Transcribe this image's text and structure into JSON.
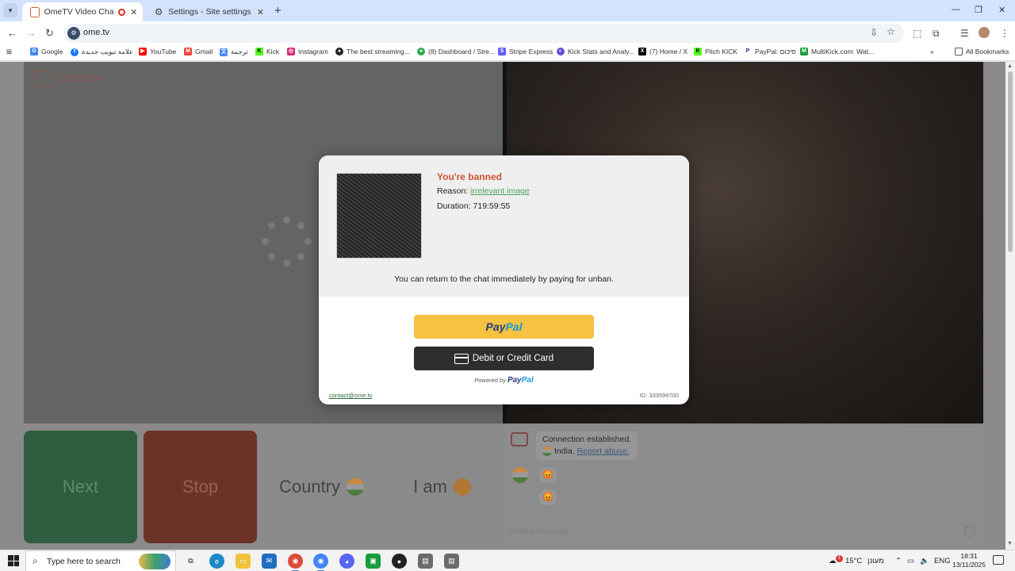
{
  "browser": {
    "tabs": [
      {
        "title": "OmeTV Video Chat — Ome",
        "active": true
      },
      {
        "title": "Settings - Site settings",
        "active": false
      }
    ],
    "url": "ome.tv",
    "bookmarks": [
      {
        "label": "Google",
        "icon": "google-icon",
        "color": "#4285f4"
      },
      {
        "label": "علامة تبويب جديدة",
        "icon": "facebook-icon",
        "color": "#1877f2"
      },
      {
        "label": "YouTube",
        "icon": "youtube-icon",
        "color": "#ff0000"
      },
      {
        "label": "Gmail",
        "icon": "gmail-icon",
        "color": "#ea4335"
      },
      {
        "label": "ترجمة",
        "icon": "translate-icon",
        "color": "#4285f4"
      },
      {
        "label": "Kick",
        "icon": "kick-icon",
        "color": "#53fc18"
      },
      {
        "label": "Instagram",
        "icon": "instagram-icon",
        "color": "#d62976"
      },
      {
        "label": "The best streaming...",
        "icon": "streaming-icon",
        "color": "#222222"
      },
      {
        "label": "(8) Dashboard / Stre...",
        "icon": "dashboard-icon",
        "color": "#2fae4e"
      },
      {
        "label": "Stripe Express",
        "icon": "stripe-icon",
        "color": "#635bff"
      },
      {
        "label": "Kick Stats and Analy...",
        "icon": "stats-icon",
        "color": "#6d4fd6"
      },
      {
        "label": "(7) Home / X",
        "icon": "x-icon",
        "color": "#000000"
      },
      {
        "label": "Pitch KICK",
        "icon": "pitch-kick-icon",
        "color": "#53fc18"
      },
      {
        "label": "PayPal: סיכום",
        "icon": "paypal-icon",
        "color": "#253b80"
      },
      {
        "label": "MultiKick.com: Wat...",
        "icon": "multikick-icon",
        "color": "#1a9d3d"
      }
    ],
    "all_bookmarks": "All Bookmarks"
  },
  "site": {
    "logo": "Ome.tv",
    "buttons": {
      "next": "Next",
      "stop": "Stop",
      "country": "Country",
      "iam": "I am"
    },
    "chat": {
      "status": "Connection established.",
      "country": "India.",
      "report": "Report abuse.",
      "emoji": "😡",
      "input_placeholder": "Write a message"
    }
  },
  "modal": {
    "title": "You're banned",
    "reason_label": "Reason:",
    "reason_value": "irrelevant image",
    "duration_label": "Duration:",
    "duration_value": "719:59:55",
    "message": "You can return to the chat immediately by paying for unban.",
    "paypal_a": "Pay",
    "paypal_b": "Pal",
    "card_button": "Debit or Credit Card",
    "powered_by": "Powered by",
    "contact": "contact@ome.tv",
    "id": "ID: 333599700"
  },
  "taskbar": {
    "search_placeholder": "Type here to search",
    "weather": "15°C",
    "weather_text": "מעונן",
    "lang": "ENG",
    "time": "18:31",
    "date": "13/11/2025",
    "notification_count": "1",
    "apps": [
      "task-view",
      "edge",
      "file-explorer",
      "mail",
      "chrome-profile",
      "chrome",
      "discord",
      "obs-green",
      "obs",
      "terminal-a",
      "terminal-b"
    ]
  },
  "colors": {
    "banned_title": "#d0532f",
    "paypal_yellow": "#f5c242",
    "card_dark": "#2c2e2f",
    "next": "#2e5e3f",
    "stop": "#6b3327"
  }
}
